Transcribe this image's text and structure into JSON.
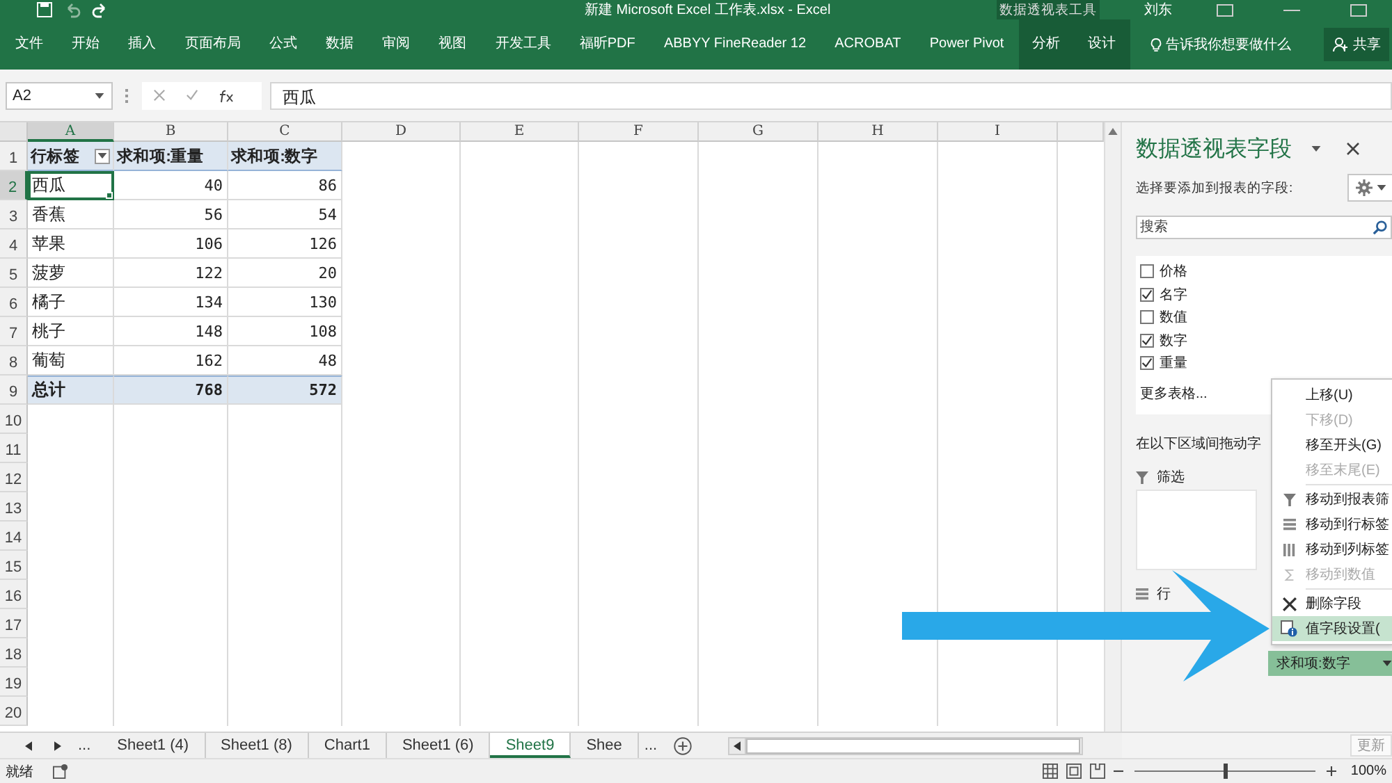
{
  "title_bar": {
    "title": "新建 Microsoft Excel 工作表.xlsx  -  Excel",
    "context_group": "数据透视表工具",
    "user": "刘东"
  },
  "ribbon": {
    "tabs": [
      {
        "label": "文件",
        "contextual": false
      },
      {
        "label": "开始",
        "contextual": false
      },
      {
        "label": "插入",
        "contextual": false
      },
      {
        "label": "页面布局",
        "contextual": false
      },
      {
        "label": "公式",
        "contextual": false
      },
      {
        "label": "数据",
        "contextual": false
      },
      {
        "label": "审阅",
        "contextual": false
      },
      {
        "label": "视图",
        "contextual": false
      },
      {
        "label": "开发工具",
        "contextual": false
      },
      {
        "label": "福昕PDF",
        "contextual": false
      },
      {
        "label": "ABBYY FineReader 12",
        "contextual": false
      },
      {
        "label": "ACROBAT",
        "contextual": false
      },
      {
        "label": "Power Pivot",
        "contextual": false
      },
      {
        "label": "分析",
        "contextual": true
      },
      {
        "label": "设计",
        "contextual": true
      }
    ],
    "tell_me": "告诉我你想要做什么",
    "share": "共享"
  },
  "formula_bar": {
    "name_box": "A2",
    "value": "西瓜"
  },
  "sheet": {
    "columns": [
      {
        "label": "A",
        "selected": true
      },
      {
        "label": "B",
        "selected": false
      },
      {
        "label": "C",
        "selected": false
      },
      {
        "label": "D",
        "selected": false
      },
      {
        "label": "E",
        "selected": false
      },
      {
        "label": "F",
        "selected": false
      },
      {
        "label": "G",
        "selected": false
      },
      {
        "label": "H",
        "selected": false
      },
      {
        "label": "I",
        "selected": false
      }
    ],
    "row_headers": [
      {
        "label": "1",
        "selected": false
      },
      {
        "label": "2",
        "selected": true
      },
      {
        "label": "3",
        "selected": false
      },
      {
        "label": "4",
        "selected": false
      },
      {
        "label": "5",
        "selected": false
      },
      {
        "label": "6",
        "selected": false
      },
      {
        "label": "7",
        "selected": false
      },
      {
        "label": "8",
        "selected": false
      },
      {
        "label": "9",
        "selected": false
      },
      {
        "label": "10",
        "selected": false
      },
      {
        "label": "11",
        "selected": false
      },
      {
        "label": "12",
        "selected": false
      },
      {
        "label": "13",
        "selected": false
      },
      {
        "label": "14",
        "selected": false
      },
      {
        "label": "15",
        "selected": false
      },
      {
        "label": "16",
        "selected": false
      },
      {
        "label": "17",
        "selected": false
      },
      {
        "label": "18",
        "selected": false
      },
      {
        "label": "19",
        "selected": false
      },
      {
        "label": "20",
        "selected": false
      }
    ],
    "pivot": {
      "header": [
        "行标签",
        "求和项:重量",
        "求和项:数字"
      ],
      "rows": [
        {
          "label": "西瓜",
          "values": [
            "40",
            "86"
          ],
          "active": true
        },
        {
          "label": "香蕉",
          "values": [
            "56",
            "54"
          ],
          "active": false
        },
        {
          "label": "苹果",
          "values": [
            "106",
            "126"
          ],
          "active": false
        },
        {
          "label": "菠萝",
          "values": [
            "122",
            "20"
          ],
          "active": false
        },
        {
          "label": "橘子",
          "values": [
            "134",
            "130"
          ],
          "active": false
        },
        {
          "label": "桃子",
          "values": [
            "148",
            "108"
          ],
          "active": false
        },
        {
          "label": "葡萄",
          "values": [
            "162",
            "48"
          ],
          "active": false
        }
      ],
      "total": [
        "总计",
        "768",
        "572"
      ]
    }
  },
  "pivot_panel": {
    "title": "数据透视表字段",
    "subtitle": "选择要添加到报表的字段:",
    "search_placeholder": "搜索",
    "fields": [
      {
        "label": "价格",
        "checked": false
      },
      {
        "label": "名字",
        "checked": true
      },
      {
        "label": "数值",
        "checked": false
      },
      {
        "label": "数字",
        "checked": true
      },
      {
        "label": "重量",
        "checked": true
      }
    ],
    "more_tables": "更多表格...",
    "drag_hint": "在以下区域间拖动字",
    "filter_area": "筛选",
    "rows_area": "行",
    "value_item": "求和项:数字",
    "update": "更新"
  },
  "context_menu": [
    {
      "label": "上移(U)",
      "kind": "plain",
      "disabled": false,
      "selected": false
    },
    {
      "label": "下移(D)",
      "kind": "plain",
      "disabled": true,
      "selected": false
    },
    {
      "label": "移至开头(G)",
      "kind": "plain",
      "disabled": false,
      "selected": false
    },
    {
      "label": "移至末尾(E)",
      "kind": "plain",
      "disabled": true,
      "selected": false
    },
    {
      "label": "移动到报表筛",
      "kind": "filter",
      "disabled": false,
      "selected": false
    },
    {
      "label": "移动到行标签",
      "kind": "rows",
      "disabled": false,
      "selected": false
    },
    {
      "label": "移动到列标签",
      "kind": "columns",
      "disabled": false,
      "selected": false
    },
    {
      "label": "移动到数值",
      "kind": "sum",
      "disabled": true,
      "selected": false
    },
    {
      "label": "删除字段",
      "kind": "remove",
      "disabled": false,
      "selected": false
    },
    {
      "label": "值字段设置(",
      "kind": "settings",
      "disabled": false,
      "selected": true
    }
  ],
  "sheet_nav": {
    "more_before": "...",
    "more_after": "..."
  },
  "sheet_tabs": [
    {
      "label": "Sheet1 (4)",
      "selected": false
    },
    {
      "label": "Sheet1 (8)",
      "selected": false
    },
    {
      "label": "Chart1",
      "selected": false
    },
    {
      "label": "Sheet1 (6)",
      "selected": false
    },
    {
      "label": "Sheet9",
      "selected": true
    },
    {
      "label": "Shee",
      "selected": false
    }
  ],
  "status_bar": {
    "status": "就绪",
    "zoom": "100%",
    "level": 0.5
  }
}
